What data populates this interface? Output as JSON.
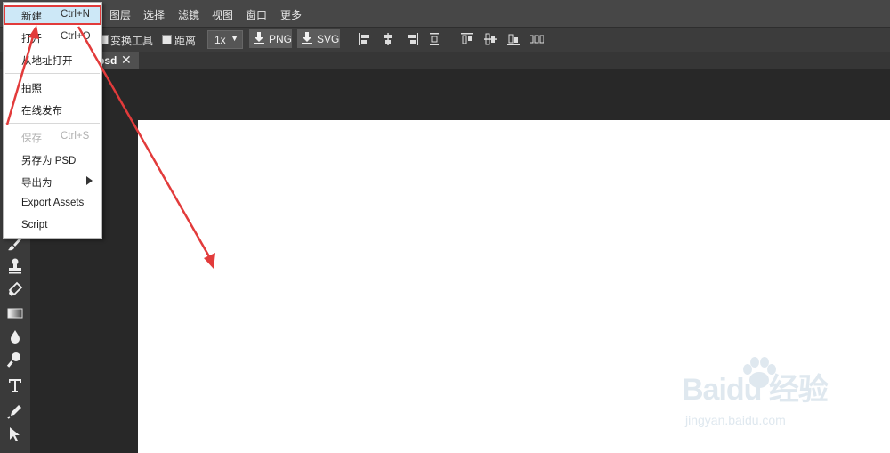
{
  "menubar": {
    "items": [
      "图层",
      "选择",
      "滤镜",
      "视图",
      "窗口",
      "更多"
    ]
  },
  "options_bar": {
    "transform_label": "变换工具",
    "distance_label": "距离",
    "scale_value": "1x",
    "export_png_label": "PNG",
    "export_svg_label": "SVG"
  },
  "document_tab": {
    "name": "psd",
    "close": "✕"
  },
  "file_menu": {
    "items": [
      {
        "label": "新建",
        "shortcut": "Ctrl+N",
        "highlighted": true
      },
      {
        "label": "打开",
        "shortcut": "Ctrl+O"
      },
      {
        "label": "从地址打开"
      },
      {
        "label": "拍照"
      },
      {
        "label": "在线发布"
      },
      {
        "label": "保存",
        "shortcut": "Ctrl+S",
        "disabled": true
      },
      {
        "label": "另存为 PSD"
      },
      {
        "label": "导出为",
        "has_submenu": true
      },
      {
        "label": "Export Assets"
      },
      {
        "label": "Script"
      }
    ]
  },
  "watermark": {
    "logo_text": "Baidu 经验",
    "url": "jingyan.baidu.com"
  },
  "colors": {
    "menubar": "#474747",
    "workspace": "#282828",
    "highlight_fill": "#cde8f7",
    "annotation_red": "#e23b3b"
  },
  "icons": [
    "align-left-icon",
    "align-center-icon",
    "align-right-icon",
    "distribute-icon",
    "brush-icon",
    "stamp-icon",
    "eraser-icon",
    "gradient-icon",
    "blur-drop-icon",
    "dodge-icon",
    "text-tool-icon",
    "pen-tool-icon",
    "path-select-icon",
    "download-icon"
  ]
}
